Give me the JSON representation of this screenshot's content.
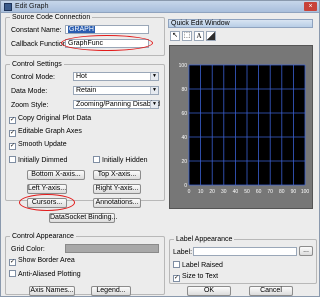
{
  "window": {
    "title": "Edit Graph",
    "close_glyph": "×"
  },
  "source": {
    "legend": "Source Code Connection",
    "constant_label": "Constant Name:",
    "constant_value": "GRAPH",
    "callback_label": "Callback Function:",
    "callback_value": "GraphFunc"
  },
  "control_settings": {
    "legend": "Control Settings",
    "control_mode_label": "Control Mode:",
    "control_mode_value": "Hot",
    "data_mode_label": "Data Mode:",
    "data_mode_value": "Retain",
    "zoom_style_label": "Zoom Style:",
    "zoom_style_value": "Zooming/Panning Disabled",
    "copy_original_label": "Copy Original Plot Data",
    "editable_axes_label": "Editable Graph Axes",
    "smooth_update_label": "Smooth Update",
    "initially_dimmed_label": "Initially Dimmed",
    "initially_hidden_label": "Initially Hidden",
    "bottom_xaxis_label": "Bottom X-axis...",
    "top_xaxis_label": "Top X-axis...",
    "left_yaxis_label": "Left Y-axis...",
    "right_yaxis_label": "Right Y-axis...",
    "cursors_label": "Cursors...",
    "annotations_label": "Annotations...",
    "datasocket_label": "DataSocket Binding..."
  },
  "control_appearance": {
    "legend": "Control Appearance",
    "grid_color_label": "Grid Color:",
    "grid_color": "#a8a8a8",
    "show_border_label": "Show Border Area",
    "anti_aliased_label": "Anti-Aliased Plotting",
    "axis_names_label": "Axis Names...",
    "legend_button_label": "Legend..."
  },
  "quick_edit": {
    "header": "Quick Edit Window",
    "y_ticks": [
      "100",
      "80",
      "60",
      "40",
      "20",
      "0"
    ],
    "x_ticks": [
      "0",
      "10",
      "20",
      "30",
      "40",
      "50",
      "60",
      "70",
      "80",
      "90",
      "100"
    ],
    "plot_bg": "#000000",
    "grid_color": "#3a5fd0"
  },
  "label_appearance": {
    "legend": "Label Appearance",
    "label_label": "Label:",
    "label_value": "",
    "browse_label": "...",
    "label_raised_label": "Label Raised",
    "size_to_text_label": "Size to Text"
  },
  "footer": {
    "ok_label": "OK",
    "cancel_label": "Cancel"
  }
}
